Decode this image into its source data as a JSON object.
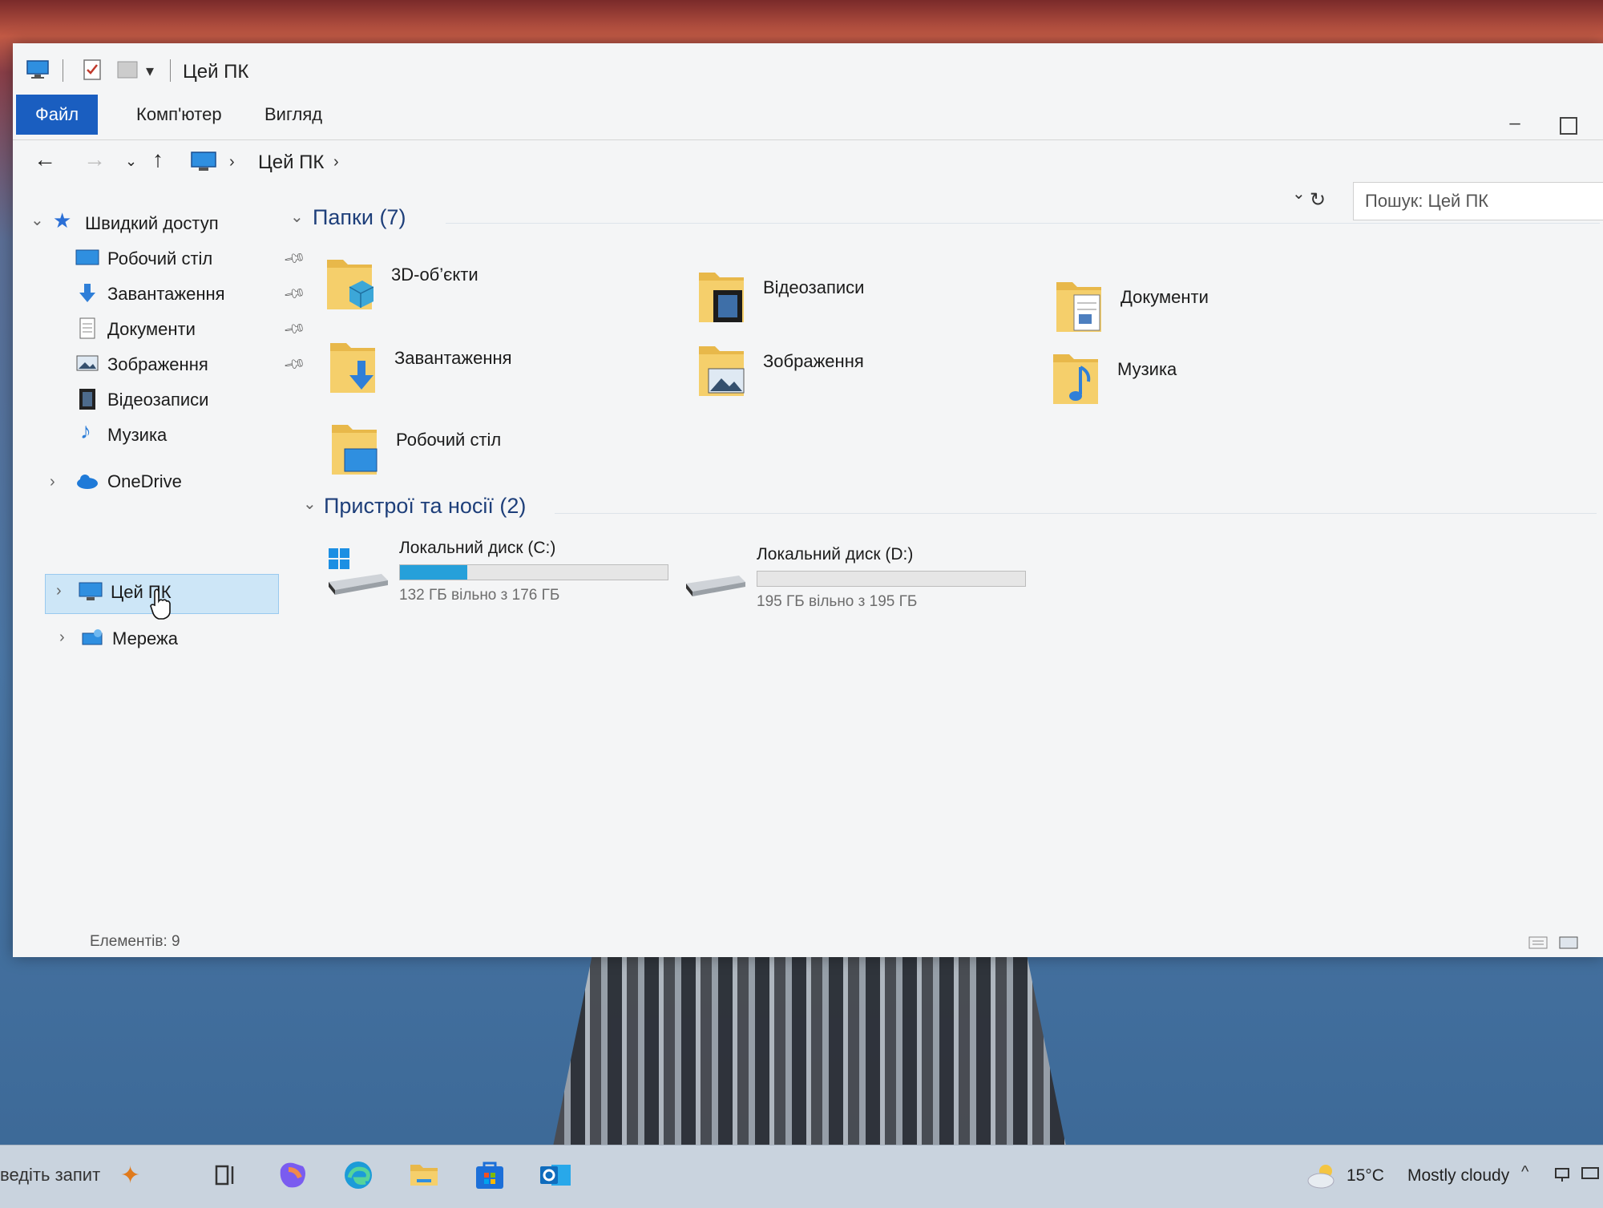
{
  "window": {
    "title": "Цей ПК",
    "ribbon_tabs": [
      {
        "label": "Файл"
      },
      {
        "label": "Комп'ютер"
      },
      {
        "label": "Вигляд"
      }
    ]
  },
  "address": {
    "breadcrumb": "Цей ПК",
    "search_placeholder": "Пошук: Цей ПК"
  },
  "nav_pane": {
    "quick_access": {
      "label": "Швидкий доступ",
      "items": [
        {
          "label": "Робочий стіл",
          "icon": "desktop-icon",
          "pinned": true
        },
        {
          "label": "Завантаження",
          "icon": "downloads-icon",
          "pinned": true
        },
        {
          "label": "Документи",
          "icon": "documents-icon",
          "pinned": true
        },
        {
          "label": "Зображення",
          "icon": "pictures-icon",
          "pinned": true
        },
        {
          "label": "Відеозаписи",
          "icon": "videos-icon",
          "pinned": false
        },
        {
          "label": "Музика",
          "icon": "music-icon",
          "pinned": false
        }
      ]
    },
    "onedrive": {
      "label": "OneDrive"
    },
    "this_pc": {
      "label": "Цей ПК",
      "selected": true
    },
    "network": {
      "label": "Мережа"
    }
  },
  "content": {
    "folders_header": "Папки (7)",
    "folders": [
      {
        "label": "3D-об’єкти",
        "icon": "3d-objects-icon"
      },
      {
        "label": "Відеозаписи",
        "icon": "videos-icon"
      },
      {
        "label": "Документи",
        "icon": "documents-icon"
      },
      {
        "label": "Завантаження",
        "icon": "downloads-icon"
      },
      {
        "label": "Зображення",
        "icon": "pictures-icon"
      },
      {
        "label": "Музика",
        "icon": "music-icon"
      },
      {
        "label": "Робочий стіл",
        "icon": "desktop-icon"
      }
    ],
    "devices_header": "Пристрої та носії (2)",
    "drives": [
      {
        "label": "Локальний диск (C:)",
        "free_text": "132 ГБ вільно з 176 ГБ",
        "used_fraction": 0.25,
        "icon": "windows-drive-icon"
      },
      {
        "label": "Локальний диск (D:)",
        "free_text": "195 ГБ вільно з 195 ГБ",
        "used_fraction": 0.0,
        "icon": "drive-icon"
      }
    ]
  },
  "status": {
    "items_text": "Елементів: 9"
  },
  "taskbar": {
    "search_text": "ведіть запит",
    "weather_temp": "15°C",
    "weather_desc": "Mostly cloudy",
    "apps": [
      "copilot-icon",
      "edge-icon",
      "file-explorer-icon",
      "store-icon",
      "outlook-icon"
    ]
  },
  "colors": {
    "accent": "#1a5ec0",
    "selection": "#cde6f7",
    "drive_bar": "#26a0da",
    "group_header": "#1e3f7a"
  }
}
